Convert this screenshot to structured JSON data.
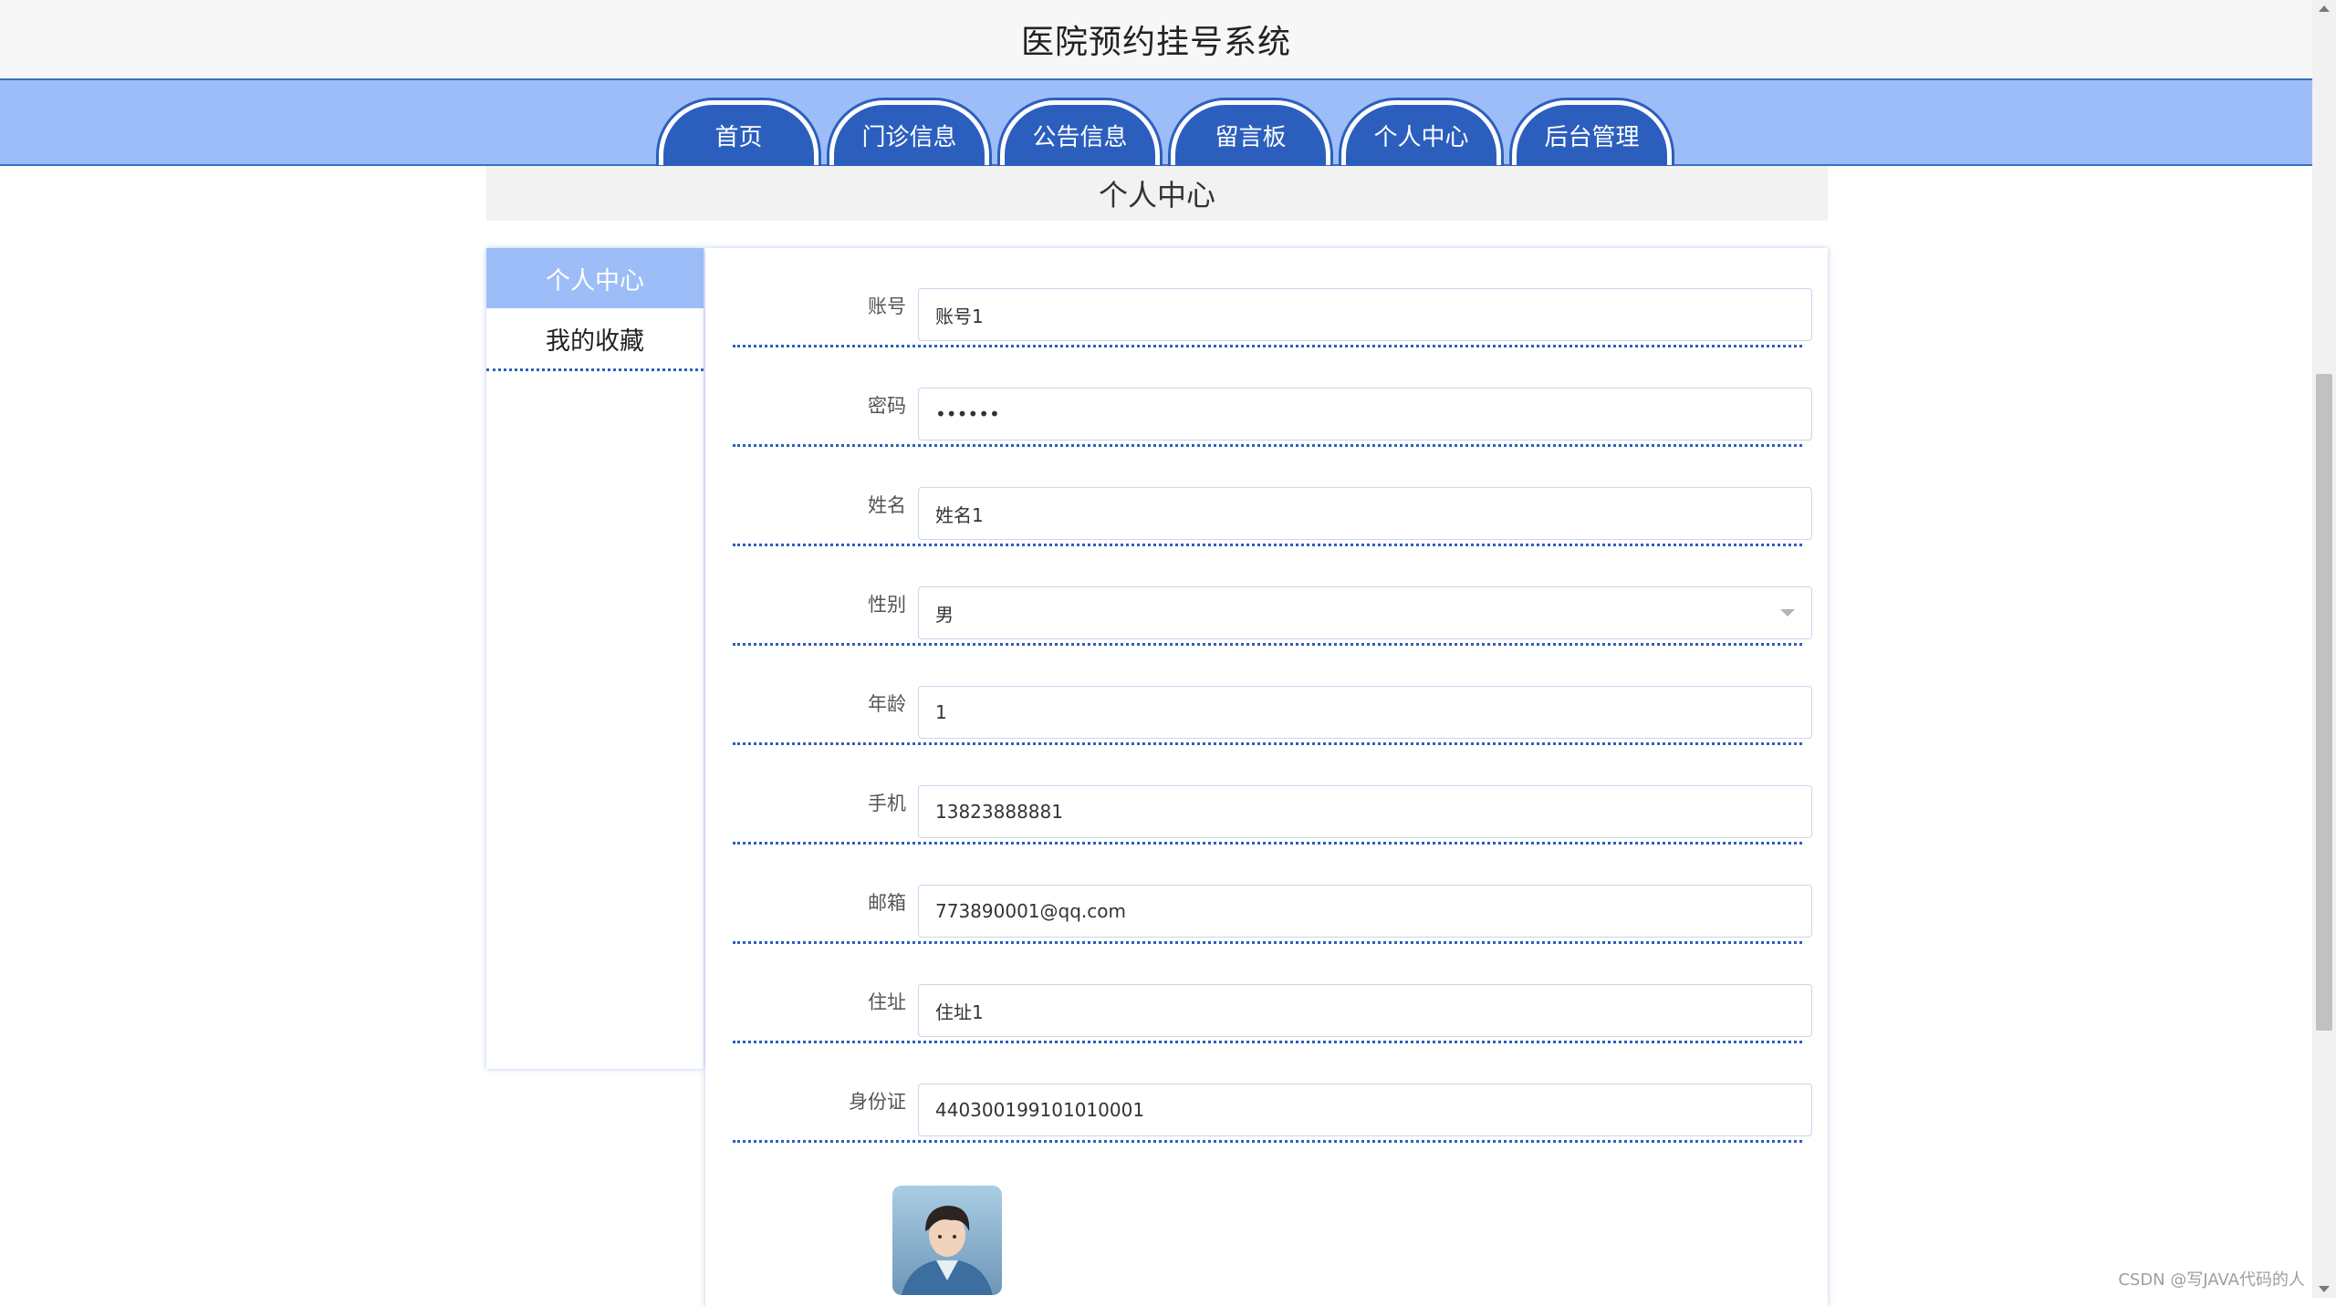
{
  "site": {
    "title": "医院预约挂号系统"
  },
  "nav": {
    "items": [
      {
        "label": "首页"
      },
      {
        "label": "门诊信息"
      },
      {
        "label": "公告信息"
      },
      {
        "label": "留言板"
      },
      {
        "label": "个人中心"
      },
      {
        "label": "后台管理"
      }
    ]
  },
  "page": {
    "heading": "个人中心"
  },
  "sidebar": {
    "items": [
      {
        "label": "个人中心",
        "active": true
      },
      {
        "label": "我的收藏",
        "active": false
      }
    ]
  },
  "form": {
    "fields": [
      {
        "label": "账号",
        "value": "账号1"
      },
      {
        "label": "密码",
        "value": "••••••"
      },
      {
        "label": "姓名",
        "value": "姓名1"
      },
      {
        "label": "性别",
        "value": "男",
        "type": "select"
      },
      {
        "label": "年龄",
        "value": "1"
      },
      {
        "label": "手机",
        "value": "13823888881"
      },
      {
        "label": "邮箱",
        "value": "773890001@qq.com"
      },
      {
        "label": "住址",
        "value": "住址1"
      },
      {
        "label": "身份证",
        "value": "440300199101010001"
      }
    ]
  },
  "colors": {
    "nav_bg": "#9dbdf8",
    "nav_tab": "#2c5fbd",
    "accent_border": "#3a6fc4"
  },
  "watermark": "CSDN @写JAVA代码的人"
}
